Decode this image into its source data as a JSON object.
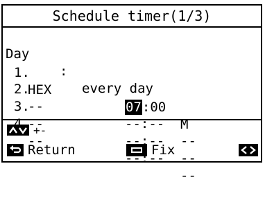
{
  "header": {
    "title": "Schedule timer(1/3)"
  },
  "day": {
    "label": "Day",
    "separator": ":",
    "value": "every day"
  },
  "entries": [
    {
      "index": "1.",
      "name": "HEX",
      "time_hour": "07",
      "time_rest": ":00",
      "mode": "M"
    },
    {
      "index": "2.",
      "name": "--",
      "time": "--:--",
      "mode": "--"
    },
    {
      "index": "3.",
      "name": "--",
      "time": "--:--",
      "mode": "--"
    },
    {
      "index": "4.",
      "name": "--",
      "time": "--:--",
      "mode": "--"
    }
  ],
  "hints": {
    "updown_icon": "up-down-arrows-icon",
    "updown_label": "+-"
  },
  "footer": {
    "return_icon": "return-arrow-icon",
    "return_label": "Return",
    "fix_icon": "square-icon",
    "fix_label": "Fix",
    "nav_icon": "left-right-arrows-icon"
  }
}
